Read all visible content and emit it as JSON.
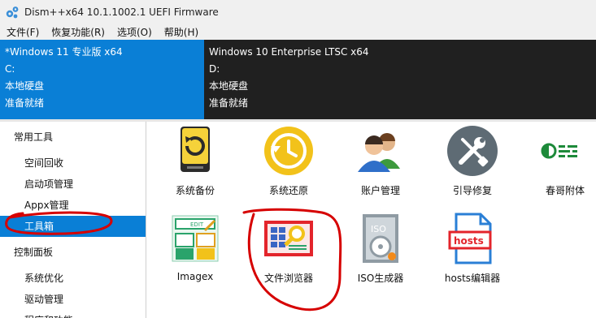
{
  "window": {
    "title": "Dism++x64 10.1.1002.1 UEFI Firmware"
  },
  "menu": [
    "文件(F)",
    "恢复功能(R)",
    "选项(O)",
    "帮助(H)"
  ],
  "sessions": [
    {
      "name": "*Windows 11 专业版 x64",
      "drive": "C:",
      "type": "本地硬盘",
      "status": "准备就绪",
      "active": true
    },
    {
      "name": "Windows 10 Enterprise LTSC x64",
      "drive": "D:",
      "type": "本地硬盘",
      "status": "准备就绪",
      "active": false
    }
  ],
  "sidebar": {
    "group1": "常用工具",
    "items1": [
      "空间回收",
      "启动项管理",
      "Appx管理",
      "工具箱"
    ],
    "selected": "工具箱",
    "group2": "控制面板",
    "items2": [
      "系统优化",
      "驱动管理",
      "程序和功能"
    ]
  },
  "tools": [
    {
      "label": "系统备份",
      "icon": "backup-drive-icon"
    },
    {
      "label": "系统还原",
      "icon": "restore-clock-icon"
    },
    {
      "label": "账户管理",
      "icon": "users-icon"
    },
    {
      "label": "引导修复",
      "icon": "wrench-screwdriver-icon"
    },
    {
      "label": "春哥附体",
      "icon": "toggle-panel-icon"
    },
    {
      "label": "Imagex",
      "icon": "imagex-icon"
    },
    {
      "label": "文件浏览器",
      "icon": "file-explorer-icon"
    },
    {
      "label": "ISO生成器",
      "icon": "iso-disc-icon"
    },
    {
      "label": "hosts编辑器",
      "icon": "hosts-file-icon"
    }
  ],
  "colors": {
    "accent": "#0a7fd6",
    "dark_panel": "#202020",
    "annotation": "#d60000"
  }
}
